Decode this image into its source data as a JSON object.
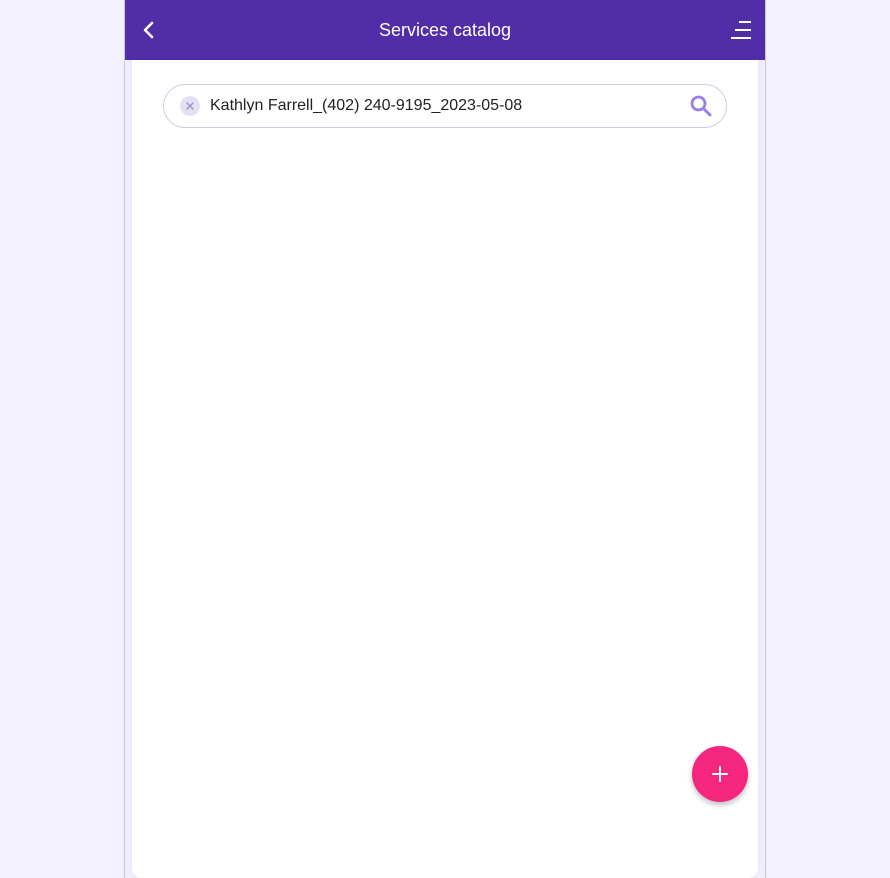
{
  "header": {
    "title": "Services catalog",
    "back_icon": "chevron-left-icon",
    "menu_icon": "menu-icon"
  },
  "search": {
    "value": "Kathlyn Farrell_(402) 240-9195_2023-05-08",
    "clear_icon": "close-icon",
    "search_icon": "search-icon"
  },
  "fab": {
    "icon": "plus-icon"
  },
  "colors": {
    "header_bg": "#512da8",
    "accent": "#f4267d",
    "search_icon": "#9c7ee6"
  }
}
